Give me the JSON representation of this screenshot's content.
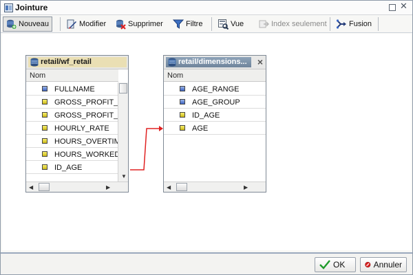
{
  "window": {
    "title": "Jointure"
  },
  "toolbar": {
    "buttons": [
      {
        "label": "Nouveau",
        "icon": "new-join-icon"
      },
      {
        "label": "Modifier",
        "icon": "edit-icon"
      },
      {
        "label": "Supprimer",
        "icon": "delete-icon"
      },
      {
        "label": "Filtre",
        "icon": "filter-icon"
      },
      {
        "label": "Vue",
        "icon": "view-icon"
      },
      {
        "label": "Index seulement",
        "icon": "index-only-icon"
      },
      {
        "label": "Fusion",
        "icon": "merge-icon"
      }
    ]
  },
  "tables": {
    "left": {
      "title": "retail/wf_retail",
      "column_header": "Nom",
      "fields": [
        {
          "label": "FULLNAME",
          "type": "blue"
        },
        {
          "label": "GROSS_PROFIT_L",
          "type": "yellow"
        },
        {
          "label": "GROSS_PROFIT_L",
          "type": "yellow"
        },
        {
          "label": "HOURLY_RATE",
          "type": "yellow"
        },
        {
          "label": "HOURS_OVERTIME",
          "type": "yellow"
        },
        {
          "label": "HOURS_WORKED",
          "type": "yellow"
        },
        {
          "label": "ID_AGE",
          "type": "yellow"
        }
      ]
    },
    "right": {
      "title": "retail/dimensions...",
      "column_header": "Nom",
      "fields": [
        {
          "label": "AGE_RANGE",
          "type": "blue"
        },
        {
          "label": "AGE_GROUP",
          "type": "blue"
        },
        {
          "label": "ID_AGE",
          "type": "yellow"
        },
        {
          "label": "AGE",
          "type": "yellow"
        }
      ]
    }
  },
  "footer": {
    "ok_label": "OK",
    "cancel_label": "Annuler"
  },
  "colors": {
    "link_line": "#e02020",
    "accent": "#7f96b3"
  }
}
